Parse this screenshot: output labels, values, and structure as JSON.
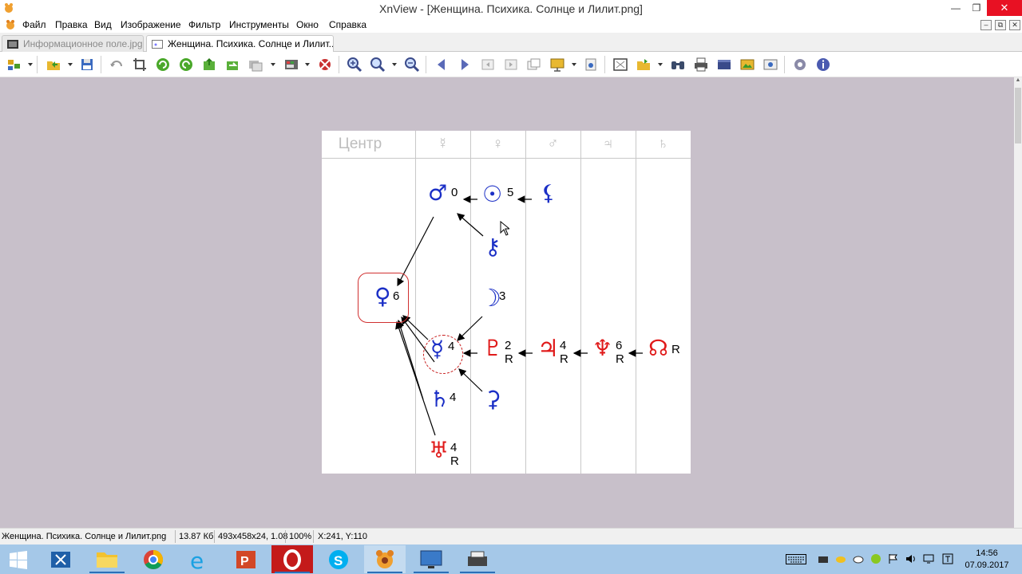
{
  "window": {
    "title": "XnView - [Женщина. Психика. Солнце и Лилит.png]",
    "minimize": "—",
    "maximize": "❐",
    "close": "✕"
  },
  "menu": {
    "items": [
      "Файл",
      "Правка",
      "Вид",
      "Изображение",
      "Фильтр",
      "Инструменты",
      "Окно",
      "Справка"
    ],
    "mdi": [
      "–",
      "⧉",
      "✕"
    ]
  },
  "tabs": [
    {
      "label": "Информационное поле.jpg",
      "active": false
    },
    {
      "label": "Женщина. Психика. Солнце и Лилит...",
      "active": true
    }
  ],
  "image": {
    "headers": [
      "Центр",
      "☿",
      "♀",
      "♂",
      "♃",
      "♄"
    ],
    "glyphs": {
      "mars": "♂",
      "sun": "☉",
      "lilith": "⚸",
      "chiron": "⚷",
      "venus": "♀",
      "moon": "☽",
      "mercury": "☿",
      "pluto": "♇",
      "jupiter": "♃",
      "neptune": "♆",
      "node": "☊",
      "saturn": "♄",
      "uranus": "♅",
      "ceres": "⚳"
    },
    "labels": {
      "mars": "0",
      "sun": "5",
      "venus": "6",
      "moon": "3",
      "mercury": "4",
      "pluto_num": "2",
      "pluto_r": "R",
      "jupiter_num": "4",
      "jupiter_r": "R",
      "neptune_num": "6",
      "neptune_r": "R",
      "node_r": "R",
      "saturn": "4",
      "uranus_num": "4",
      "uranus_r": "R"
    }
  },
  "status": {
    "filename": "Женщина. Психика. Солнце и Лилит.png",
    "filesize": "13.87 Кб",
    "dimensions": "493x458x24, 1.08",
    "zoom": "100%",
    "coords": "X:241, Y:110"
  },
  "taskbar": {
    "time": "14:56",
    "date": "07.09.2017"
  },
  "colors": {
    "viewer_bg": "#c8c0ca",
    "astro_blue": "#1b2fc6",
    "astro_red": "#e01a1a",
    "close_red": "#e81123",
    "taskbar": "#a5c8e8"
  }
}
